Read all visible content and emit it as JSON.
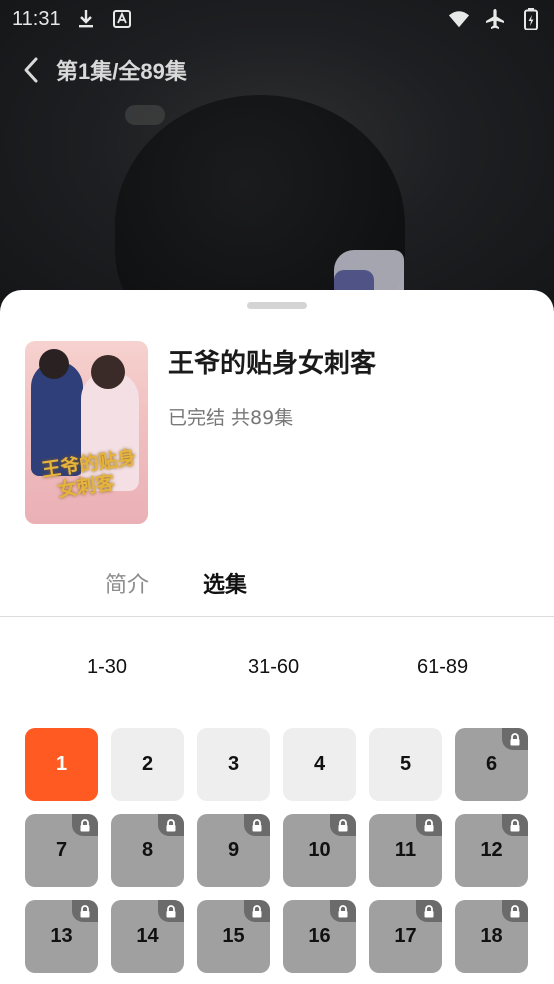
{
  "status_bar": {
    "time": "11:31",
    "left_icons": [
      "download-icon",
      "a-badge-icon"
    ],
    "right_icons": [
      "wifi-icon",
      "airplane-icon",
      "battery-icon"
    ]
  },
  "header": {
    "episode_label": "第1集/全89集",
    "back_icon": "chevron-left-icon"
  },
  "drama": {
    "title": "王爷的贴身女刺客",
    "status": "已完结 共89集",
    "poster_text": "王爷的贴身女刺客"
  },
  "tabs": [
    {
      "label": "简介",
      "active": false
    },
    {
      "label": "选集",
      "active": true
    }
  ],
  "ranges": [
    "1-30",
    "31-60",
    "61-89"
  ],
  "episodes": [
    {
      "number": "1",
      "state": "current"
    },
    {
      "number": "2",
      "state": "free"
    },
    {
      "number": "3",
      "state": "free"
    },
    {
      "number": "4",
      "state": "free"
    },
    {
      "number": "5",
      "state": "free"
    },
    {
      "number": "6",
      "state": "locked"
    },
    {
      "number": "7",
      "state": "locked"
    },
    {
      "number": "8",
      "state": "locked"
    },
    {
      "number": "9",
      "state": "locked"
    },
    {
      "number": "10",
      "state": "locked"
    },
    {
      "number": "11",
      "state": "locked"
    },
    {
      "number": "12",
      "state": "locked"
    },
    {
      "number": "13",
      "state": "locked"
    },
    {
      "number": "14",
      "state": "locked"
    },
    {
      "number": "15",
      "state": "locked"
    },
    {
      "number": "16",
      "state": "locked"
    },
    {
      "number": "17",
      "state": "locked"
    },
    {
      "number": "18",
      "state": "locked"
    }
  ],
  "colors": {
    "accent": "#ff5a22",
    "free_tile": "#eeeeee",
    "locked_tile": "#a0a0a0"
  }
}
